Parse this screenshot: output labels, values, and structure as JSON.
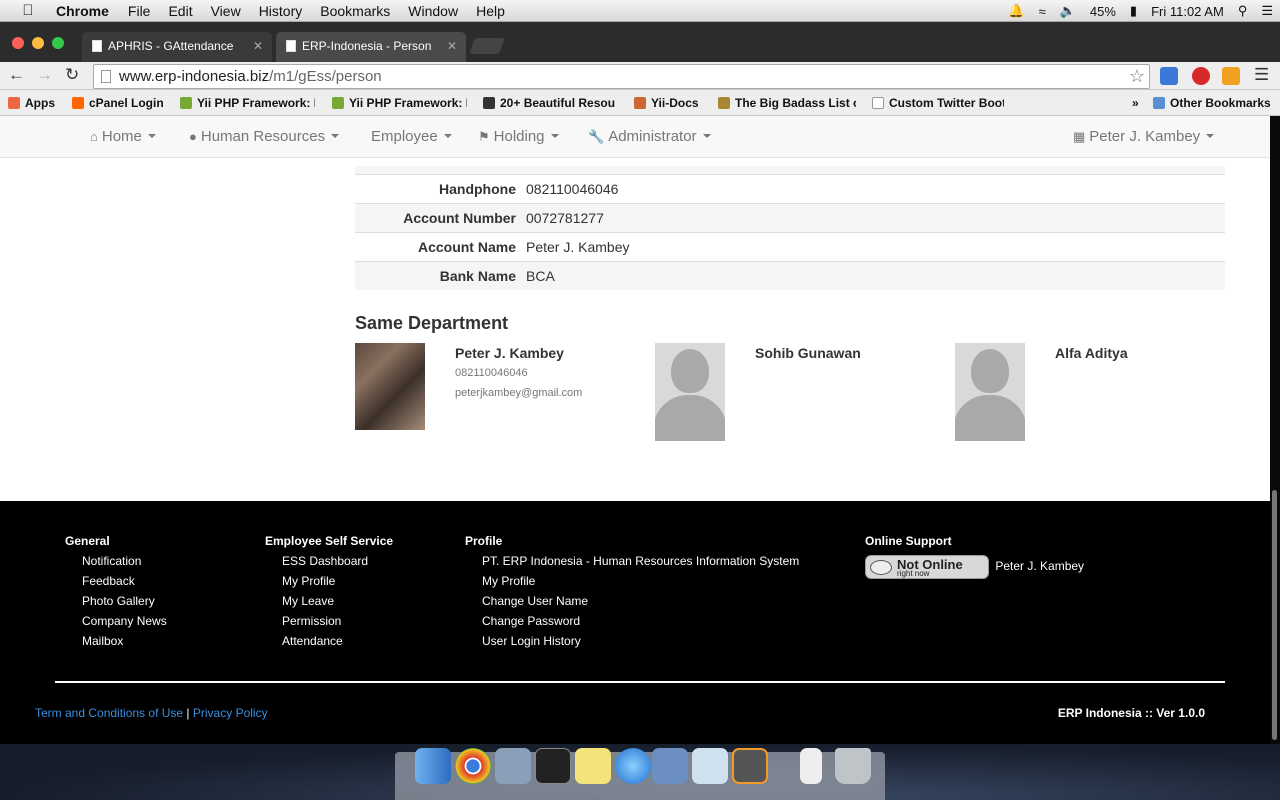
{
  "menubar": {
    "app_name": "Chrome",
    "items": [
      "File",
      "Edit",
      "View",
      "History",
      "Bookmarks",
      "Window",
      "Help"
    ],
    "battery": "45%",
    "clock": "Fri 11:02 AM"
  },
  "tabs": [
    {
      "title": "APHRIS - GAttendance"
    },
    {
      "title": "ERP-Indonesia - Person GE"
    }
  ],
  "omnibox": {
    "domain": "www.erp-indonesia.biz",
    "path": "/m1/gEss/person"
  },
  "bookmarks": [
    {
      "label": "Apps"
    },
    {
      "label": "cPanel Login"
    },
    {
      "label": "Yii PHP Framework: B"
    },
    {
      "label": "Yii PHP Framework: D"
    },
    {
      "label": "20+ Beautiful Resou"
    },
    {
      "label": "Yii-Docs"
    },
    {
      "label": "The Big Badass List o"
    },
    {
      "label": "Custom Twitter Boot"
    },
    {
      "label": "»"
    },
    {
      "label": "Other Bookmarks"
    }
  ],
  "navbar": {
    "items": [
      {
        "label": "Home",
        "icon": "home-icon"
      },
      {
        "label": "Human Resources",
        "icon": "user-icon"
      },
      {
        "label": "Employee",
        "icon": ""
      },
      {
        "label": "Holding",
        "icon": "flag-icon"
      },
      {
        "label": "Administrator",
        "icon": "wrench-icon"
      }
    ],
    "user": "Peter J. Kambey"
  },
  "details": [
    {
      "label": "Handphone",
      "value": "082110046046"
    },
    {
      "label": "Account Number",
      "value": "0072781277"
    },
    {
      "label": "Account Name",
      "value": "Peter J. Kambey"
    },
    {
      "label": "Bank Name",
      "value": "BCA"
    }
  ],
  "same_department": {
    "title": "Same Department",
    "people": [
      {
        "name": "Peter J. Kambey",
        "phone": "082110046046",
        "email": "peterjkambey@gmail.com"
      },
      {
        "name": "Sohib Gunawan"
      },
      {
        "name": "Alfa Aditya"
      }
    ]
  },
  "footer": {
    "general": {
      "heading": "General",
      "links": [
        "Notification",
        "Feedback",
        "Photo Gallery",
        "Company News",
        "Mailbox"
      ]
    },
    "ess": {
      "heading": "Employee Self Service",
      "links": [
        "ESS Dashboard",
        "My Profile",
        "My Leave",
        "Permission",
        "Attendance"
      ]
    },
    "profile": {
      "heading": "Profile",
      "links": [
        "PT. ERP Indonesia - Human Resources Information System",
        "My Profile",
        "Change User Name",
        "Change Password",
        "User Login History"
      ]
    },
    "support": {
      "heading": "Online Support",
      "status_main": "Not Online",
      "status_sub": "right now",
      "name": "Peter J. Kambey"
    },
    "terms": "Term and Conditions of Use",
    "separator": "|",
    "privacy": "Privacy Policy",
    "version": "ERP Indonesia :: Ver 1.0.0"
  }
}
